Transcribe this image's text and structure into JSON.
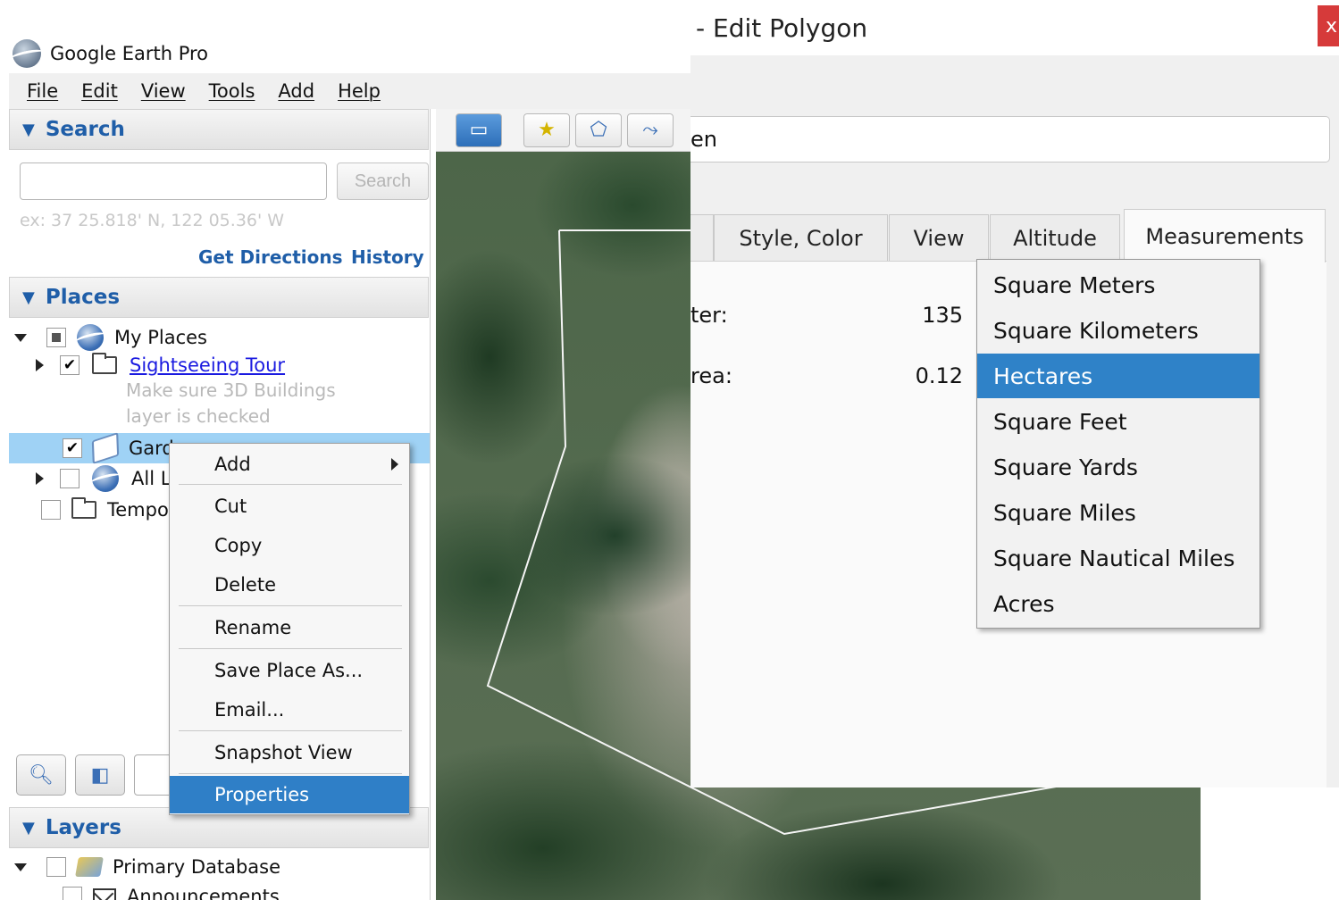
{
  "app": {
    "title": "Google Earth Pro",
    "menu": [
      "File",
      "Edit",
      "View",
      "Tools",
      "Add",
      "Help"
    ]
  },
  "search_panel": {
    "header": "Search",
    "input_value": "",
    "button_label": "Search",
    "hint": "ex: 37 25.818' N, 122 05.36' W",
    "get_directions": "Get Directions",
    "history": "History"
  },
  "places_panel": {
    "header": "Places",
    "my_places": "My Places",
    "sightseeing_tour": "Sightseeing Tour",
    "sightseeing_desc_1": "Make sure 3D Buildings",
    "sightseeing_desc_2": "layer is checked",
    "garden_item": "Gard",
    "all_layers_item": "All La",
    "temporary_item": "Tempor"
  },
  "layers_panel": {
    "header": "Layers",
    "primary_database": "Primary Database",
    "announcements": "Announcements"
  },
  "context_menu": {
    "items": [
      "Add",
      "Cut",
      "Copy",
      "Delete",
      "Rename",
      "Save Place As...",
      "Email...",
      "Snapshot View",
      "Properties"
    ],
    "highlighted": "Properties"
  },
  "dialog": {
    "title": "- Edit Polygon",
    "close_label": "x",
    "name_value_fragment": "en",
    "tabs": [
      "Style, Color",
      "View",
      "Altitude",
      "Measurements"
    ],
    "active_tab": "Measurements",
    "perimeter_label_fragment": "ter:",
    "perimeter_value": "135",
    "area_label_fragment": "rea:",
    "area_value": "0.12"
  },
  "unit_dropdown": {
    "options": [
      "Square Meters",
      "Square Kilometers",
      "Hectares",
      "Square Feet",
      "Square Yards",
      "Square Miles",
      "Square Nautical Miles",
      "Acres"
    ],
    "selected": "Hectares"
  },
  "colors": {
    "accent_blue": "#2f82c8",
    "header_text": "#1f5ea8",
    "selection_row": "#9fd2f5",
    "close_red": "#d63a3a"
  }
}
